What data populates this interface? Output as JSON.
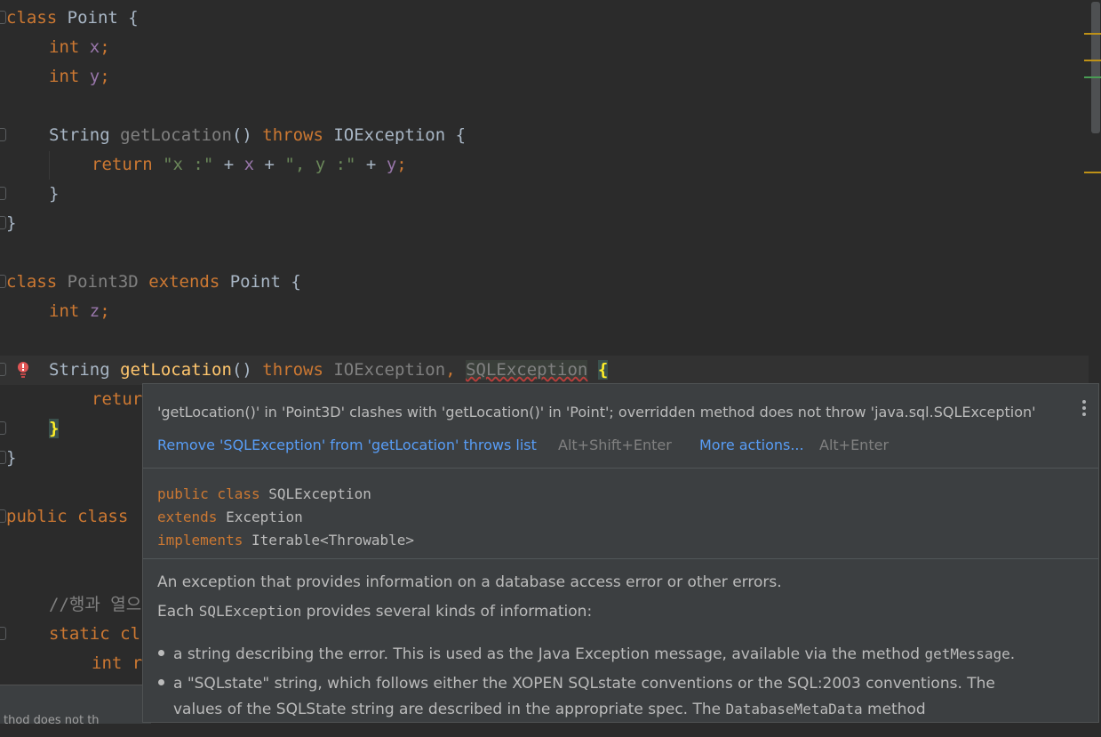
{
  "editor": {
    "lines": {
      "l1": {
        "kw1": "class",
        "name": "Point",
        "punct": " {"
      },
      "l2": {
        "kw": "int",
        "fld": "x",
        "punct": ";"
      },
      "l3": {
        "kw": "int",
        "fld": "y",
        "punct": ";"
      },
      "l5": {
        "type": "String",
        "method": "getLocation",
        "parens": "() ",
        "kw": "throws",
        "exc": "IOException",
        "punct": " {"
      },
      "l6": {
        "kw": "return",
        "s1": "\"x :\"",
        "op1": " + ",
        "f1": "x",
        "op2": " + ",
        "s2": "\", y :\"",
        "op3": " + ",
        "f2": "y",
        "punct": ";"
      },
      "l7": {
        "text": "}"
      },
      "l8": {
        "text": "}"
      },
      "l10": {
        "kw1": "class",
        "name": "Point3D",
        "kw2": "extends",
        "base": "Point",
        "punct": " {"
      },
      "l11": {
        "kw": "int",
        "fld": "z",
        "punct": ";"
      },
      "l13": {
        "type": "String",
        "method": "getLocation",
        "parens": "() ",
        "kw": "throws",
        "exc1": "IOException",
        "comma": ", ",
        "exc2": "SQLException",
        "brace": "{"
      },
      "l14": {
        "kw": "retur"
      },
      "l15": {
        "brace": "}"
      },
      "l16": {
        "text": "}"
      },
      "l18": {
        "kw": "public class"
      },
      "l20": {
        "cmt": "//행과 열으"
      },
      "l21": {
        "kw": "static cl"
      },
      "l22": {
        "kw": "int r"
      }
    }
  },
  "bottom": {
    "text": "thod does not th"
  },
  "popup": {
    "message": "'getLocation()' in 'Point3D' clashes with 'getLocation()' in 'Point'; overridden method does not throw 'java.sql.SQLException'",
    "fix_label": "Remove 'SQLException' from 'getLocation' throws list",
    "fix_shortcut": "Alt+Shift+Enter",
    "more_label": "More actions...",
    "more_shortcut": "Alt+Enter",
    "decl": {
      "l1_kw": "public class",
      "l1_name": "SQLException",
      "l2_kw": "extends",
      "l2_name": "Exception",
      "l3_kw": "implements",
      "l3_name": "Iterable<Throwable>"
    },
    "doc": {
      "p1": "An exception that provides information on a database access error or other errors.",
      "p2_a": "Each ",
      "p2_code": "SQLException",
      "p2_b": " provides several kinds of information:",
      "b1_a": "a string describing the error. This is used as the Java Exception message, available via the method ",
      "b1_code": "getMessage",
      "b1_b": ".",
      "b2_l1": "a \"SQLstate\" string, which follows either the XOPEN SQLstate conventions or the SQL:2003 conventions. The",
      "b2_l2_a": "values of the SQLState string are described in the appropriate spec. The ",
      "b2_l2_code": "DatabaseMetaData",
      "b2_l2_b": " method"
    }
  },
  "colors": {
    "keyword": "#cc7832",
    "field": "#9876aa",
    "string": "#6a8759",
    "method": "#ffc66d",
    "link": "#589df6",
    "error": "#bc3f3c"
  },
  "icons": {
    "gutter": "fold-marker-icon",
    "error": "error-bulb-icon",
    "menu": "more-vertical-icon"
  }
}
